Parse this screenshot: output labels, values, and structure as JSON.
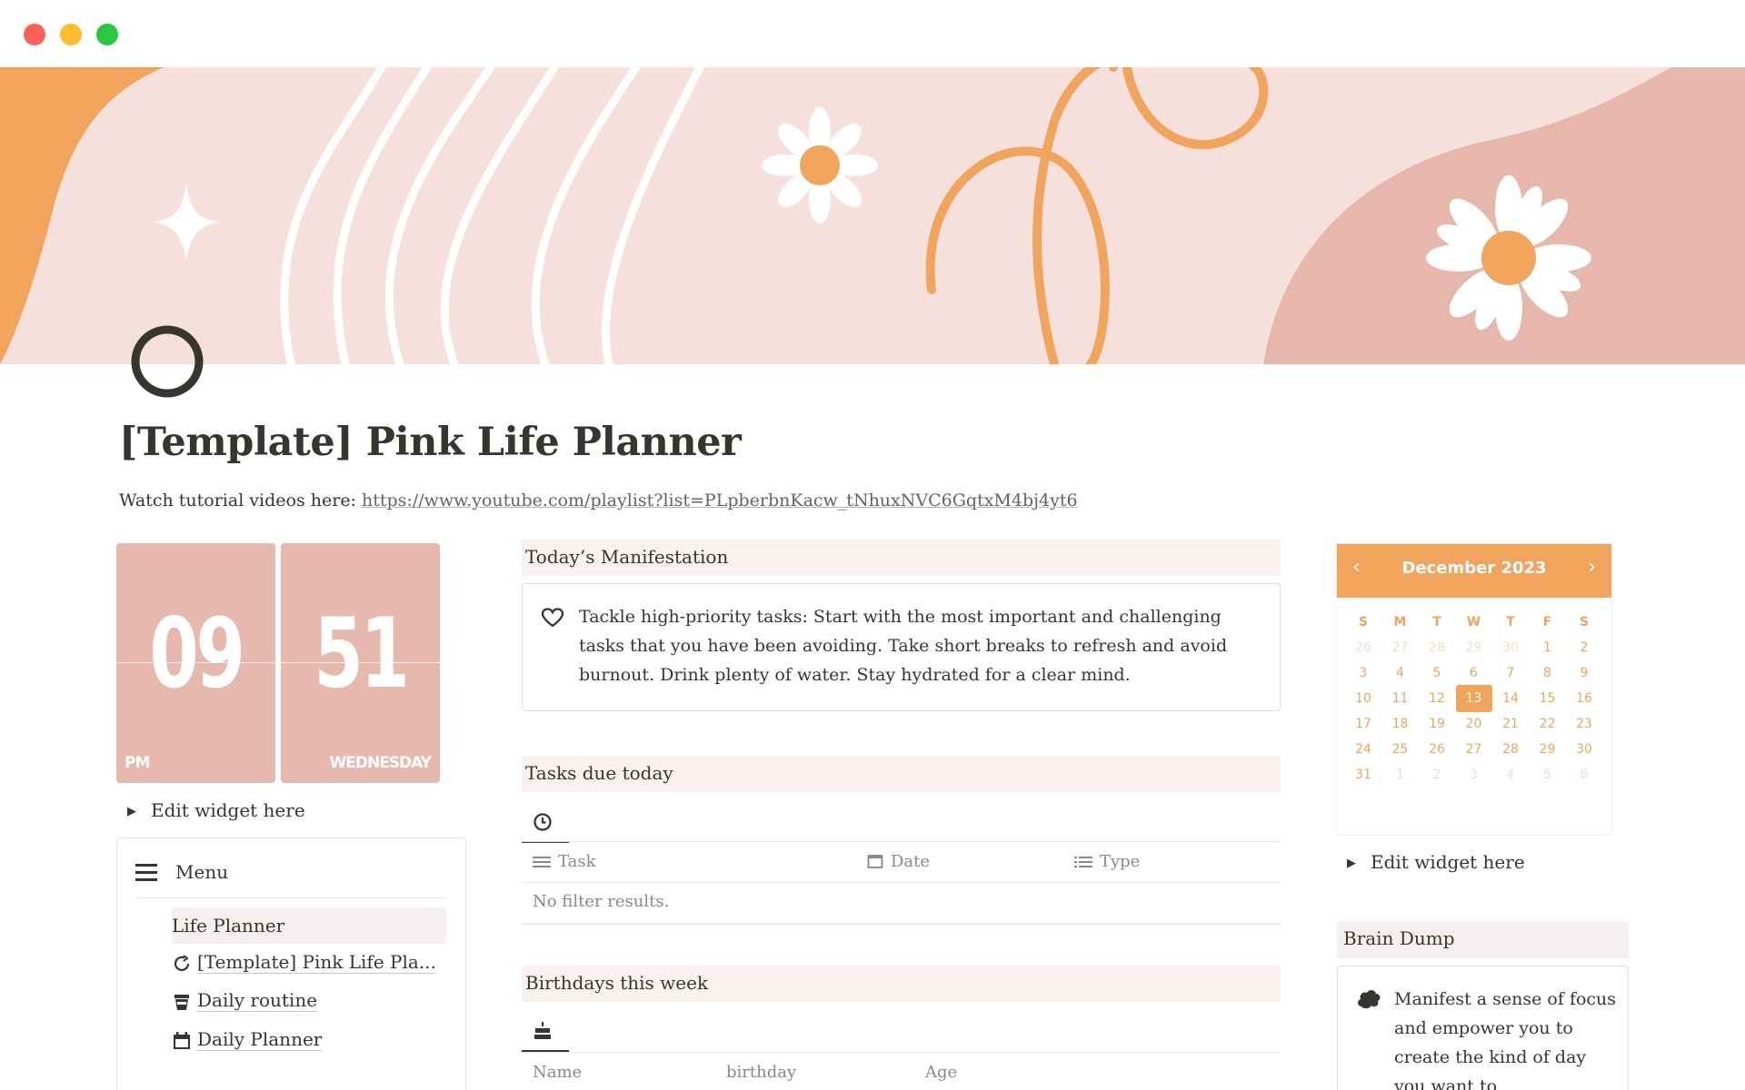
{
  "window": {
    "controls": [
      "close",
      "minimize",
      "maximize"
    ]
  },
  "page": {
    "title": "[Template] Pink Life Planner",
    "tutorial_label": "Watch tutorial videos here:",
    "tutorial_url": "https://www.youtube.com/playlist?list=PLpberbnKacw_tNhuxNVC6GqtxM4bj4yt6"
  },
  "clock": {
    "hour": "09",
    "minute": "51",
    "meridiem": "PM",
    "weekday": "WEDNESDAY",
    "edit_label": "Edit widget here"
  },
  "menu": {
    "title": "Menu",
    "section": "Life Planner",
    "items": [
      {
        "label": "[Template] Pink Life Pla...",
        "icon": "refresh-icon"
      },
      {
        "label": "Daily routine",
        "icon": "cup-icon"
      },
      {
        "label": "Daily Planner",
        "icon": "calendar-icon"
      }
    ]
  },
  "manifestation": {
    "heading": "Today’s Manifestation",
    "text": "Tackle high-priority tasks: Start with the most important and challenging tasks that you have been avoiding. Take short breaks to refresh and avoid burnout. Drink plenty of water. Stay hydrated for a clear mind."
  },
  "tasks": {
    "heading": "Tasks due today",
    "columns": [
      "Task",
      "Date",
      "Type"
    ],
    "empty": "No filter results."
  },
  "birthdays": {
    "heading": "Birthdays this week",
    "columns": [
      "Name",
      "birthday",
      "Age"
    ]
  },
  "calendar": {
    "month": "December 2023",
    "prev": "‹",
    "next": "›",
    "weekdays": [
      "S",
      "M",
      "T",
      "W",
      "T",
      "F",
      "S"
    ],
    "weeks": [
      [
        "26",
        "27",
        "28",
        "29",
        "30",
        "1",
        "2"
      ],
      [
        "3",
        "4",
        "5",
        "6",
        "7",
        "8",
        "9"
      ],
      [
        "10",
        "11",
        "12",
        "13",
        "14",
        "15",
        "16"
      ],
      [
        "17",
        "18",
        "19",
        "20",
        "21",
        "22",
        "23"
      ],
      [
        "24",
        "25",
        "26",
        "27",
        "28",
        "29",
        "30"
      ],
      [
        "31",
        "1",
        "2",
        "3",
        "4",
        "5",
        "6"
      ]
    ],
    "today": "13",
    "edit_label": "Edit widget here",
    "accent": "#f0a45c"
  },
  "brain_dump": {
    "heading": "Brain Dump",
    "text": "Manifest a sense of focus and empower you to create the kind of day you want to"
  },
  "colors": {
    "cover_bg": "#f5e0db",
    "orange": "#f0a45c",
    "pink_block": "#e7b8ad",
    "section_bg": "#f9f0f0"
  }
}
